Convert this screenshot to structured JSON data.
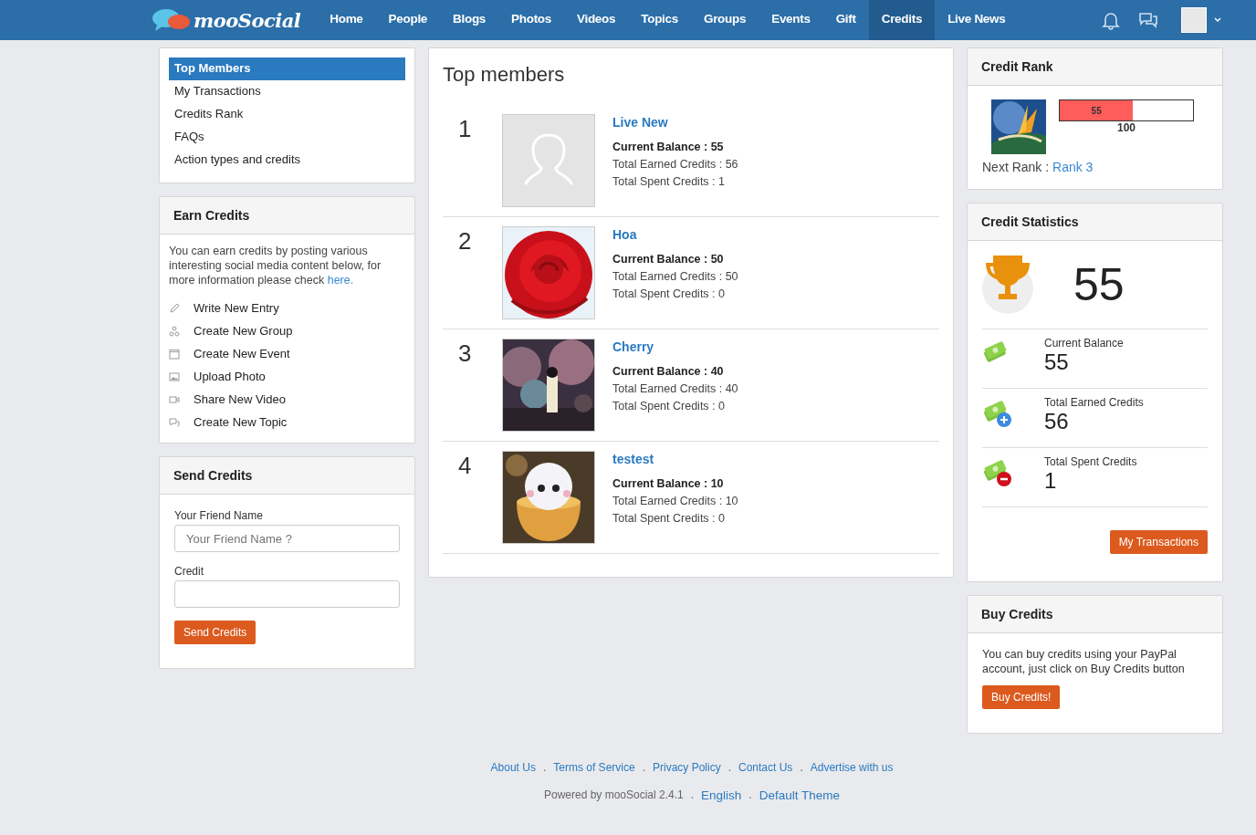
{
  "nav": {
    "logo": "mooSocial",
    "items": [
      {
        "label": "Home",
        "selected": false
      },
      {
        "label": "People",
        "selected": false
      },
      {
        "label": "Blogs",
        "selected": false
      },
      {
        "label": "Photos",
        "selected": false
      },
      {
        "label": "Videos",
        "selected": false
      },
      {
        "label": "Topics",
        "selected": false
      },
      {
        "label": "Groups",
        "selected": false
      },
      {
        "label": "Events",
        "selected": false
      },
      {
        "label": "Gift",
        "selected": false
      },
      {
        "label": "Credits",
        "selected": true
      },
      {
        "label": "Live News",
        "selected": false
      }
    ]
  },
  "menu": [
    {
      "label": "Top Members",
      "selected": true
    },
    {
      "label": "My Transactions",
      "selected": false
    },
    {
      "label": "Credits Rank",
      "selected": false
    },
    {
      "label": "FAQs",
      "selected": false
    },
    {
      "label": "Action types and credits",
      "selected": false
    }
  ],
  "earn": {
    "title": "Earn Credits",
    "text": "You can earn credits by posting various interesting social media content below, for more information please check ",
    "link": "here.",
    "actions": [
      {
        "kind": "entry",
        "label": "Write New Entry"
      },
      {
        "kind": "group",
        "label": "Create New Group"
      },
      {
        "kind": "event",
        "label": "Create New Event"
      },
      {
        "label": "Upload Photo"
      },
      {
        "kind": "video",
        "label": "Share New Video"
      },
      {
        "kind": "topic",
        "label": "Create New Topic"
      }
    ]
  },
  "send": {
    "title": "Send Credits",
    "friend_label": "Your Friend Name",
    "friend_placeholder": "Your Friend Name ?",
    "credit_label": "Credit",
    "button": "Send Credits"
  },
  "main": {
    "title": "Top members",
    "members": [
      {
        "rank": "1",
        "name": "Live New",
        "kind": "placeholder",
        "balance": "Current Balance : 55",
        "earned": "Total Earned Credits : 56",
        "spent": "Total Spent Credits : 1"
      },
      {
        "rank": "2",
        "name": "Hoa",
        "kind": "picture",
        "balance": "Current Balance : 50",
        "earned": "Total Earned Credits : 50",
        "spent": "Total Spent Credits : 0"
      },
      {
        "rank": "3",
        "name": "Cherry",
        "kind": "picture",
        "balance": "Current Balance : 40",
        "earned": "Total Earned Credits : 40",
        "spent": "Total Spent Credits : 0"
      },
      {
        "rank": "4",
        "name": "testest",
        "kind": "picture",
        "balance": "Current Balance : 10",
        "earned": "Total Earned Credits : 10",
        "spent": "Total Spent Credits : 0"
      }
    ]
  },
  "rank": {
    "title": "Credit Rank",
    "level": 0.55,
    "value": "55",
    "max": "100",
    "next_label": "Next Rank : ",
    "next": "Rank 3"
  },
  "stats": {
    "title": "Credit Statistics",
    "total": "55",
    "rows": [
      {
        "kind": "plain",
        "label": "Current Balance",
        "value": "55"
      },
      {
        "kind": "plus",
        "label": "Total Earned Credits",
        "value": "56"
      },
      {
        "kind": "minus",
        "label": "Total Spent Credits",
        "value": "1"
      }
    ],
    "button": "My Transactions"
  },
  "buy": {
    "title": "Buy Credits",
    "text": "You can buy credits using your PayPal account, just click on Buy Credits button",
    "button": "Buy Credits!"
  },
  "footer": {
    "separator": ".",
    "links": [
      "About Us",
      "Terms of Service",
      "Privacy Policy",
      "Contact Us",
      "Advertise with us"
    ],
    "powered": "Powered by mooSocial 2.4.1",
    "language": "English",
    "theme": "Default Theme"
  }
}
